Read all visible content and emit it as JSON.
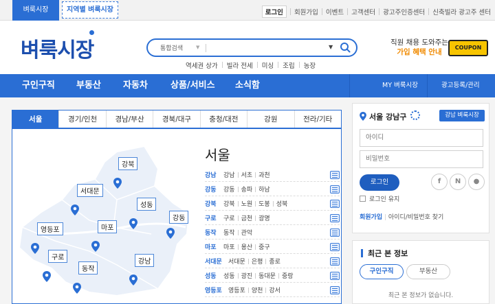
{
  "topbar": {
    "tab_main": "벼룩시장",
    "tab_regional": "지역별 벼룩시장",
    "links": [
      "로그인",
      "회원가입",
      "이벤트",
      "고객센터",
      "광고주인증센터",
      "신축빌라 광고주 센터"
    ]
  },
  "header": {
    "logo": "벼룩시장",
    "search_category": "통합검색",
    "search_placeholder": "",
    "quick_links": [
      "역세권 상가",
      "빌라 전세",
      "미싱",
      "조립",
      "농장"
    ],
    "promo_line1": "직원 채용 도와주는",
    "promo_line2": "가입 혜택 안내",
    "coupon_label": "COUPON"
  },
  "nav": {
    "items": [
      "구인구직",
      "부동산",
      "자동차",
      "상품/서비스",
      "소식함"
    ],
    "my": "MY 벼룩시장",
    "ad": "광고등록/관리"
  },
  "regions": {
    "tabs": [
      "서울",
      "경기/인천",
      "경남/부산",
      "경북/대구",
      "충청/대전",
      "강원",
      "전라/기타"
    ],
    "active": "서울",
    "city_title": "서울",
    "districts": [
      {
        "name": "강남",
        "subs": [
          "강남",
          "서초",
          "과천"
        ]
      },
      {
        "name": "강동",
        "subs": [
          "강동",
          "송파",
          "하남"
        ]
      },
      {
        "name": "강북",
        "subs": [
          "강북",
          "노원",
          "도봉",
          "성북"
        ]
      },
      {
        "name": "구로",
        "subs": [
          "구로",
          "금천",
          "광명"
        ]
      },
      {
        "name": "동작",
        "subs": [
          "동작",
          "관악"
        ]
      },
      {
        "name": "마포",
        "subs": [
          "마포",
          "용산",
          "중구"
        ]
      },
      {
        "name": "서대문",
        "subs": [
          "서대문",
          "은평",
          "종로"
        ]
      },
      {
        "name": "성동",
        "subs": [
          "성동",
          "광진",
          "동대문",
          "중랑"
        ]
      },
      {
        "name": "영등포",
        "subs": [
          "영등포",
          "양천",
          "강서"
        ]
      }
    ],
    "map_labels": {
      "gangbuk": "강북",
      "seodaemun": "서대문",
      "seongdong": "성동",
      "gangdong": "강동",
      "yeongdeungpo": "영등포",
      "mapo": "마포",
      "guro": "구로",
      "dongjak": "동작",
      "gangnam": "강남"
    }
  },
  "login": {
    "location": "서울 강남구",
    "location_button": "강남 벼룩시장",
    "id_placeholder": "아이디",
    "pw_placeholder": "비밀번호",
    "login_button": "로그인",
    "keep_login": "로그인 유지",
    "join": "회원가입",
    "find": "아이디/비밀번호 찾기"
  },
  "recent": {
    "title": "최근 본 정보",
    "tabs": [
      "구인구직",
      "부동산"
    ],
    "empty": "최근 본 정보가 없습니다."
  },
  "colors": {
    "brand": "#2a6ed4",
    "logo": "#1d4fae",
    "promo": "#f08a00",
    "coupon": "#f7c400"
  }
}
